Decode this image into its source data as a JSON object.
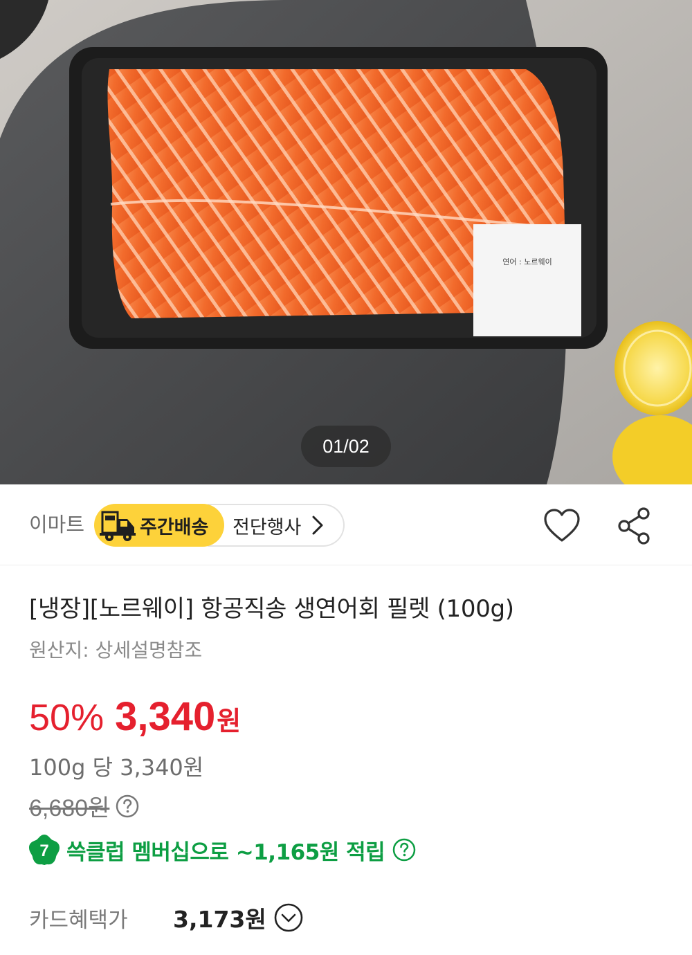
{
  "hero": {
    "page_indicator": "01/02",
    "label_text": "연어 : 노르웨이"
  },
  "seller": {
    "name": "이마트",
    "delivery_badge": "주간배송",
    "event_chip": "전단행사"
  },
  "product": {
    "title": "[냉장][노르웨이] 항공직송 생연어회 필렛 (100g)",
    "origin": "원산지: 상세설명참조"
  },
  "price": {
    "discount": "50%",
    "sale_amount": "3,340",
    "currency": "원",
    "unit_price": "100g 당 3,340원",
    "original_price": "6,680원"
  },
  "membership": {
    "badge_number": "7",
    "text": "쓱클럽 멤버십으로 ~1,165원 적립"
  },
  "card": {
    "label": "카드혜택가",
    "price": "3,173원"
  },
  "colors": {
    "sale_red": "#e5202e",
    "membership_green": "#0d9e43",
    "badge_yellow": "#fdd23a"
  },
  "icons": [
    "truck-icon",
    "chevron-right-icon",
    "heart-icon",
    "share-icon",
    "question-circle-icon",
    "ssg-club-icon",
    "chevron-down-circle-icon"
  ]
}
